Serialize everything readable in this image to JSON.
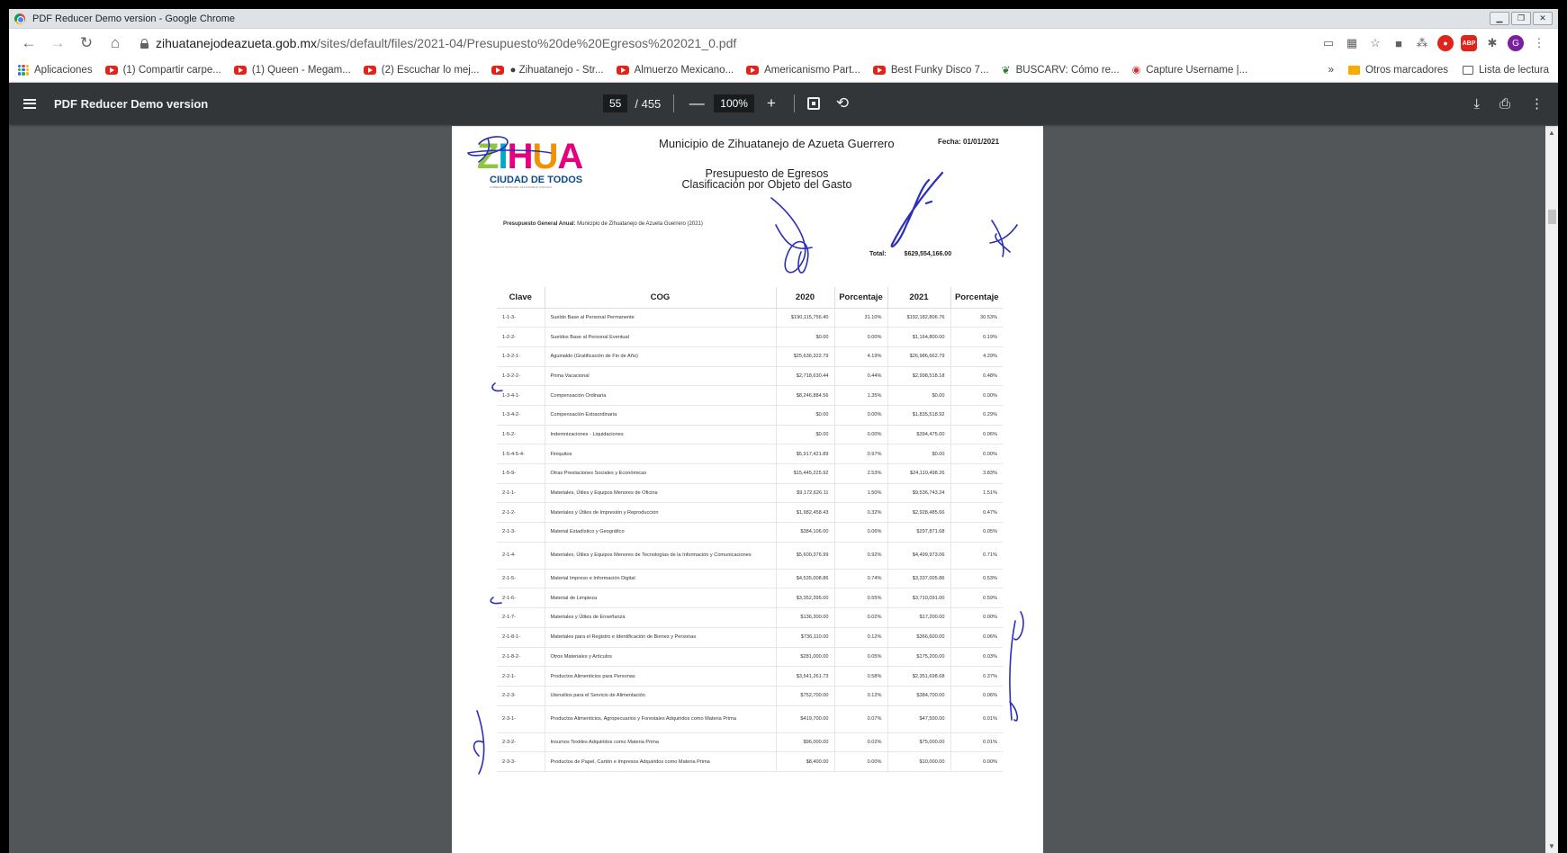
{
  "window": {
    "title": "PDF Reducer Demo version - Google Chrome",
    "controls": [
      "minimize",
      "restore",
      "close"
    ]
  },
  "addressbar": {
    "host": "zihuatanejodeazueta.gob.mx",
    "path": "/sites/default/files/2021-04/Presupuesto%20de%20Egresos%202021_0.pdf",
    "avatar_letter": "G",
    "ext_abp": "ABP"
  },
  "bookmarks": {
    "items": [
      {
        "label": "Aplicaciones"
      },
      {
        "label": "(1) Compartir carpe..."
      },
      {
        "label": "(1) Queen - Megam..."
      },
      {
        "label": "(2) Escuchar lo mej..."
      },
      {
        "label": "● Zihuatanejo - Str..."
      },
      {
        "label": "Almuerzo Mexicano..."
      },
      {
        "label": "Americanismo Part..."
      },
      {
        "label": "Best Funky Disco 7..."
      },
      {
        "label": "BUSCARV: Cómo re..."
      },
      {
        "label": "Capture Username |..."
      }
    ],
    "overflow": "»",
    "others": "Otros marcadores",
    "reading_list": "Lista de lectura"
  },
  "pdf_toolbar": {
    "title": "PDF Reducer Demo version",
    "page_current": "55",
    "page_total": "/ 455",
    "zoom": "100%",
    "minus": "—",
    "plus": "+"
  },
  "document": {
    "logo_word": [
      "Z",
      "I",
      "H",
      "U",
      "A"
    ],
    "logo_subtitle": "CIUDAD DE TODOS",
    "logo_tiny": "GOBIERNO MUNICIPAL ZIHUATANEJO 2018-2021",
    "municipality": "Municipio de Zihuatanejo de Azueta Guerrero",
    "date": "Fecha: 01/01/2021",
    "title_line1": "Presupuesto de Egresos",
    "title_line2": "Clasificación por Objeto del Gasto",
    "pga_label": "Presupuesto General Anual:",
    "pga_value": "Municipio de Zihuatanejo de Azueta Guerrero (2021)",
    "total_label": "Total:",
    "total_value": "$629,554,166.00",
    "headers": [
      "Clave",
      "COG",
      "2020",
      "Porcentaje",
      "2021",
      "Porcentaje"
    ],
    "rows": [
      [
        "1-1-3-",
        "Sueldo Base al Personal Permanente",
        "$190,115,756.40",
        "31.10%",
        "$192,182,806.76",
        "30.53%"
      ],
      [
        "1-2-2-",
        "Sueldos Base al Personal Eventual",
        "$0.00",
        "0.00%",
        "$1,164,800.00",
        "0.19%"
      ],
      [
        "1-3-2-1-",
        "Aguinaldo (Gratificación de Fin de Año)",
        "$25,636,322.79",
        "4.19%",
        "$26,986,662.79",
        "4.29%"
      ],
      [
        "1-3-2-2-",
        "Prima Vacacional",
        "$2,718,630.44",
        "0.44%",
        "$2,998,518.18",
        "0.48%"
      ],
      [
        "1-3-4-1-",
        "Compensación Ordinaria",
        "$8,246,884.56",
        "1.35%",
        "$0.00",
        "0.00%"
      ],
      [
        "1-3-4-2-",
        "Compensación Extraordinaria",
        "$0.00",
        "0.00%",
        "$1,835,518.92",
        "0.29%"
      ],
      [
        "1-5-2-",
        "Indemnizaciones - Liquidaciones",
        "$0.00",
        "0.00%",
        "$394,475.00",
        "0.06%"
      ],
      [
        "1-5-4-5-4-",
        "Finiquitos",
        "$5,917,421.89",
        "0.97%",
        "$0.00",
        "0.00%"
      ],
      [
        "1-5-9-",
        "Otras Prestaciones Sociales y Económicas",
        "$15,445,225.92",
        "2.53%",
        "$24,110,498.26",
        "3.83%"
      ],
      [
        "2-1-1-",
        "Materiales, Útiles y Equipos Menores de Oficina",
        "$9,172,626.11",
        "1.50%",
        "$9,536,743.24",
        "1.51%"
      ],
      [
        "2-1-2-",
        "Materiales y Útiles de Impresión y Reproducción",
        "$1,982,458.43",
        "0.32%",
        "$2,928,485.66",
        "0.47%"
      ],
      [
        "2-1-3-",
        "Material Estadístico y Geográfico",
        "$384,106.00",
        "0.06%",
        "$297,871.68",
        "0.05%"
      ],
      [
        "2-1-4-",
        "Materiales, Útiles y Equipos Menores de Tecnologías de la Información y Comunicaciones",
        "$5,600,376.99",
        "0.92%",
        "$4,499,973.06",
        "0.71%"
      ],
      [
        "2-1-5-",
        "Material Impreso e Información Digital",
        "$4,535,008.86",
        "0.74%",
        "$3,337,005.86",
        "0.53%"
      ],
      [
        "2-1-6-",
        "Material de Limpieza",
        "$3,352,395.00",
        "0.55%",
        "$3,710,091.00",
        "0.59%"
      ],
      [
        "2-1-7-",
        "Materiales y Útiles de Enseñanza",
        "$136,300.00",
        "0.02%",
        "$17,200.00",
        "0.00%"
      ],
      [
        "2-1-8-1-",
        "Materiales para el Registro e Identificación de Bienes y Personas",
        "$736,110.00",
        "0.12%",
        "$366,600.00",
        "0.06%"
      ],
      [
        "2-1-8-2-",
        "Otros Materiales y Artículos",
        "$281,000.00",
        "0.05%",
        "$175,200.00",
        "0.03%"
      ],
      [
        "2-2-1-",
        "Productos Alimenticios para Personas",
        "$3,541,261.73",
        "0.58%",
        "$2,351,698.68",
        "0.37%"
      ],
      [
        "2-2-3-",
        "Utensilios para el Servicio de Alimentación",
        "$752,700.00",
        "0.12%",
        "$384,700.00",
        "0.06%"
      ],
      [
        "2-3-1-",
        "Productos Alimenticios, Agropecuarios y Forestales Adquiridos como Materia Prima",
        "$419,700.00",
        "0.07%",
        "$47,500.00",
        "0.01%"
      ],
      [
        "2-3-2-",
        "Insumos Textiles Adquiridos como Materia Prima",
        "$96,000.00",
        "0.02%",
        "$75,000.00",
        "0.01%"
      ],
      [
        "2-3-3-",
        "Productos de Papel, Cartón e Impresos Adquiridos como Materia Prima",
        "$8,400.00",
        "0.00%",
        "$10,000.00",
        "0.00%"
      ]
    ]
  }
}
